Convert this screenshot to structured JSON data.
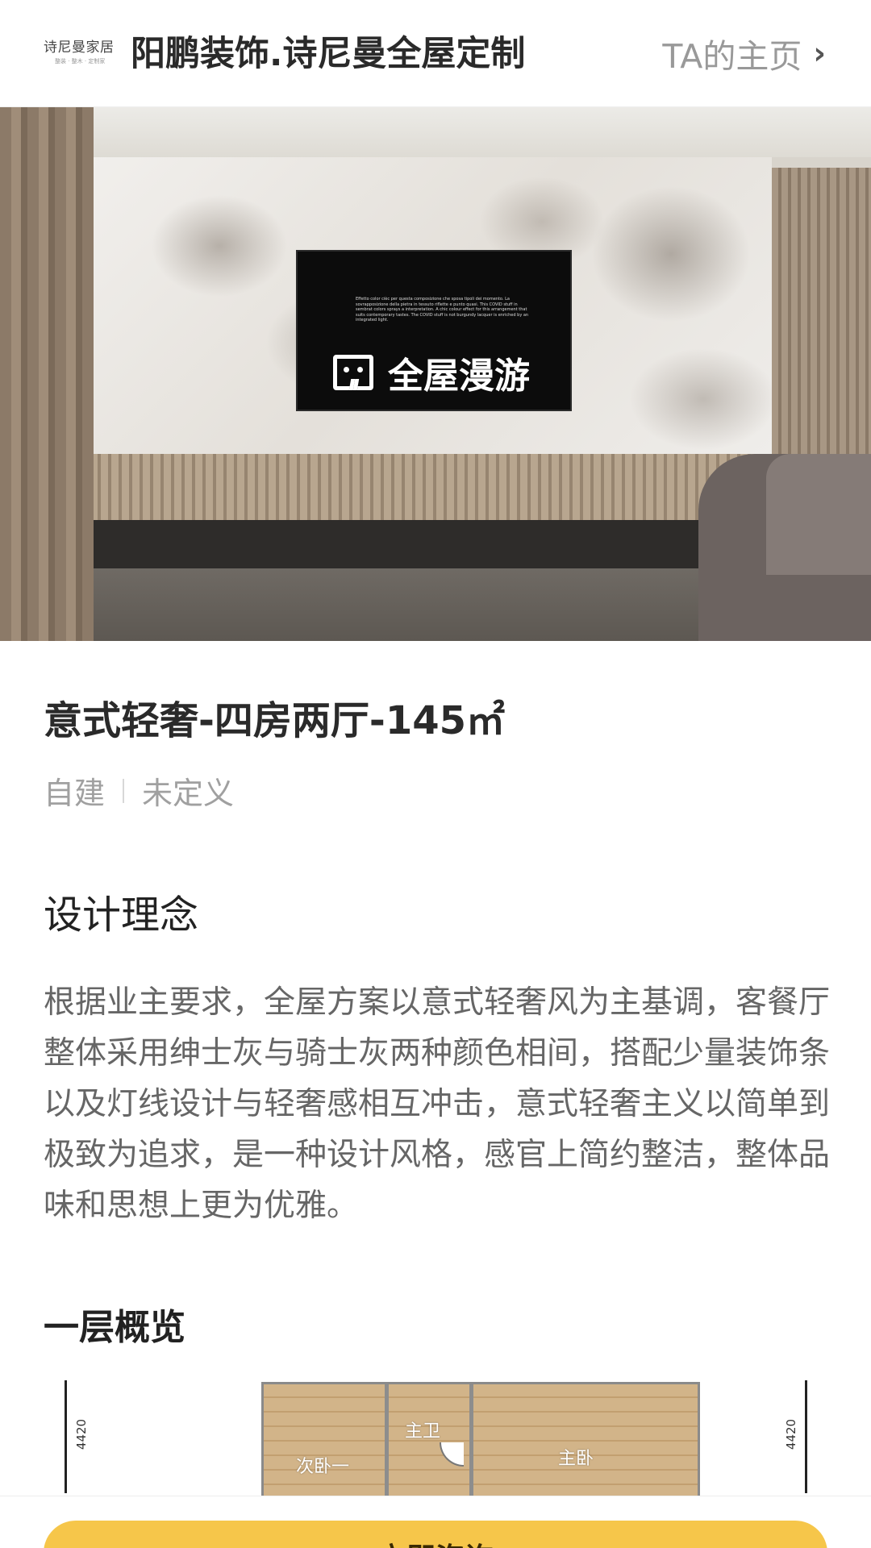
{
  "header": {
    "logo_text": "诗尼曼家居",
    "logo_sub": "整装 · 整木 · 定制家",
    "brand_title": "阳鹏装饰.诗尼曼全屋定制",
    "home_link": "TA的主页",
    "chevron": "›"
  },
  "hero": {
    "tour_label": "全屋漫游",
    "tour_icon": "vr-tour-icon",
    "tv_caption": "Effetto color cièc per questa composizione che sposa tipoli dei momento. La sovrapposizione della pietra in tessuto riflette e punto quasi. This COVID stuff in sembrat colors sprays a interpretation. A chic colour effect for this arrangement that suits contemporary tastes. The COVID stuff is not burgundy lacquer is enriched by an integrated light."
  },
  "case": {
    "title": "意式轻奢-四房两厅-145㎡",
    "tag_1": "自建",
    "tag_2": "未定义"
  },
  "concept": {
    "heading": "设计理念",
    "body": "根据业主要求，全屋方案以意式轻奢风为主基调，客餐厅整体采用绅士灰与骑士灰两种颜色相间，搭配少量装饰条以及灯线设计与轻奢感相互冲击，意式轻奢主义以简单到极致为追求，是一种设计风格，感官上简约整洁，整体品味和思想上更为优雅。"
  },
  "floor_plan": {
    "heading": "一层概览",
    "dim_left": "4420",
    "dim_right": "4420",
    "rooms": [
      "次卧一",
      "主卫",
      "主卧"
    ]
  },
  "cta": {
    "label": "立即咨询"
  },
  "colors": {
    "accent": "#f6c64a",
    "text_muted": "#a0a0a0"
  }
}
